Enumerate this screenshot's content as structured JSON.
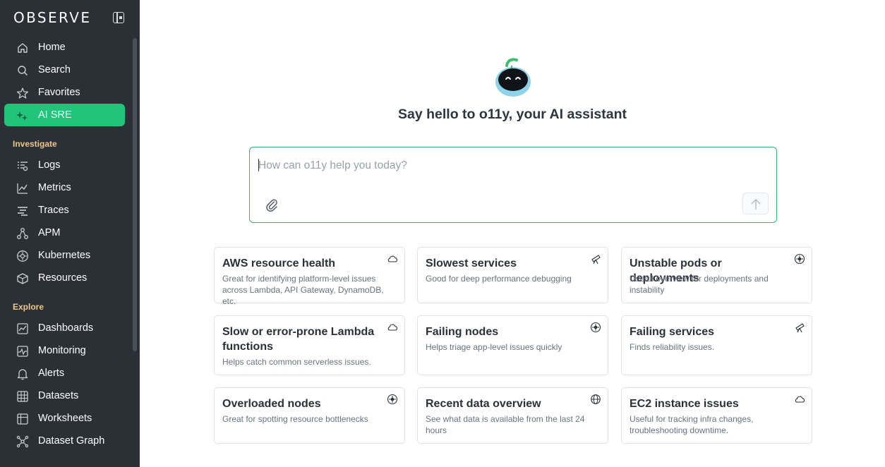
{
  "app": {
    "logo": "OBSERVE"
  },
  "sidebar": {
    "top_items": [
      {
        "label": "Home",
        "icon": "home-icon"
      },
      {
        "label": "Search",
        "icon": "search-icon"
      },
      {
        "label": "Favorites",
        "icon": "star-icon"
      },
      {
        "label": "AI SRE",
        "icon": "ai-sparkle-icon",
        "active": true
      }
    ],
    "sections": [
      {
        "title": "Investigate",
        "items": [
          {
            "label": "Logs",
            "icon": "logs-icon"
          },
          {
            "label": "Metrics",
            "icon": "metrics-icon"
          },
          {
            "label": "Traces",
            "icon": "traces-icon"
          },
          {
            "label": "APM",
            "icon": "apm-icon"
          },
          {
            "label": "Kubernetes",
            "icon": "kubernetes-icon"
          },
          {
            "label": "Resources",
            "icon": "resources-icon"
          }
        ]
      },
      {
        "title": "Explore",
        "items": [
          {
            "label": "Dashboards",
            "icon": "dashboard-icon"
          },
          {
            "label": "Monitoring",
            "icon": "monitoring-icon"
          },
          {
            "label": "Alerts",
            "icon": "bell-icon"
          },
          {
            "label": "Datasets",
            "icon": "datasets-icon"
          },
          {
            "label": "Worksheets",
            "icon": "worksheet-icon"
          },
          {
            "label": "Dataset Graph",
            "icon": "graph-icon"
          }
        ]
      }
    ]
  },
  "main": {
    "headline": "Say hello to o11y, your AI assistant",
    "prompt": {
      "placeholder": "How can o11y help you today?",
      "value": ""
    },
    "cards": [
      {
        "title": "AWS resource health",
        "desc": "Great for identifying platform-level issues across Lambda, API Gateway, DynamoDB, etc.",
        "icon": "cloud-icon"
      },
      {
        "title": "Slowest services",
        "desc": "Good for deep performance debugging",
        "icon": "telescope-icon"
      },
      {
        "title": "Unstable pods or deployments",
        "desc": "Useful overview for deployments and instability",
        "icon": "kubernetes-icon"
      },
      {
        "title": "Slow or error-prone Lambda functions",
        "desc": "Helps catch common serverless issues.",
        "icon": "cloud-icon"
      },
      {
        "title": "Failing nodes",
        "desc": "Helps triage app-level issues quickly",
        "icon": "kubernetes-icon"
      },
      {
        "title": "Failing services",
        "desc": "Finds reliability issues.",
        "icon": "telescope-icon"
      },
      {
        "title": "Overloaded nodes",
        "desc": "Great for spotting resource bottlenecks",
        "icon": "kubernetes-icon"
      },
      {
        "title": "Recent data overview",
        "desc": "See what data is available from the last 24 hours",
        "icon": "globe-icon"
      },
      {
        "title": "EC2 instance issues",
        "desc": "Useful for tracking infra changes, troubleshooting downtime.",
        "icon": "cloud-icon"
      }
    ]
  },
  "colors": {
    "sidebar_bg": "#2b3036",
    "accent": "#22c37a",
    "section_title": "#f0c58a"
  }
}
